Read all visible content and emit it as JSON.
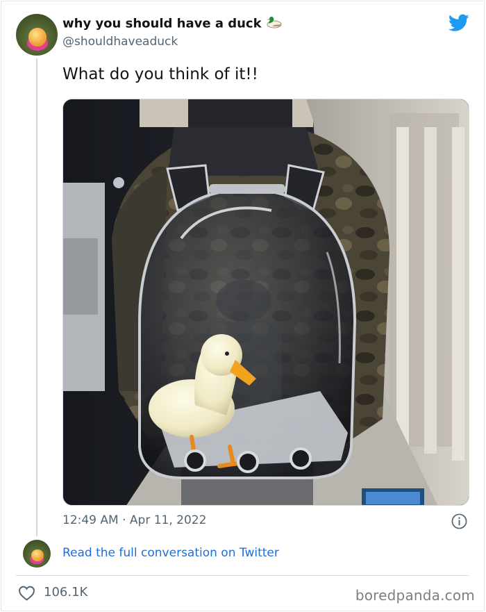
{
  "tweet": {
    "display_name": "why you should have a duck",
    "name_emoji": "duck-emoji",
    "handle": "@shouldhaveaduck",
    "text": "What do you think of it!!",
    "time": "12:49 AM",
    "separator": "·",
    "date": "Apr 11, 2022",
    "read_more": "Read the full conversation on Twitter",
    "likes": "106.1K",
    "photo_subject": "duck-in-bubble-backpack-photo"
  },
  "watermark": {
    "text": "boredpanda.com"
  },
  "colors": {
    "twitter_blue": "#1d9bf0",
    "link_blue": "#1d6fd6",
    "secondary_text": "#536471",
    "primary_text": "#0f1419"
  }
}
